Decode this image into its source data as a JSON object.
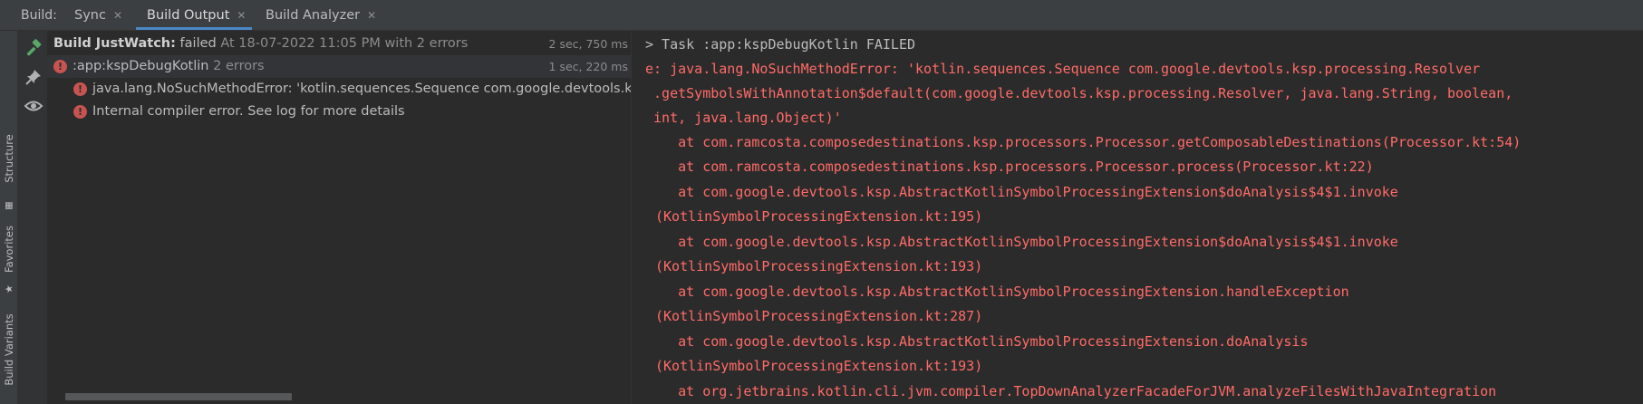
{
  "tabbar": {
    "build_label": "Build:",
    "tabs": [
      {
        "label": "Sync",
        "close": "✕"
      },
      {
        "label": "Build Output",
        "close": "✕"
      },
      {
        "label": "Build Analyzer",
        "close": "✕"
      }
    ]
  },
  "side_strip": {
    "structure_label": "Structure",
    "favorites_label": "Favorites",
    "build_variants_label": "Build Variants"
  },
  "tools": [
    "hammer-icon",
    "pin-icon",
    "eye-icon"
  ],
  "tree": {
    "root": {
      "title": "Build JustWatch:",
      "status": "failed",
      "detail": "At 18-07-2022 11:05 PM with 2 errors",
      "time": "2 sec, 750 ms"
    },
    "task": {
      "label": ":app:kspDebugKotlin",
      "count": "2 errors",
      "time": "1 sec, 220 ms"
    },
    "errors": [
      "java.lang.NoSuchMethodError: 'kotlin.sequences.Sequence com.google.devtools.ksp.processing.Resolver",
      "Internal compiler error. See log for more details"
    ]
  },
  "console": {
    "lines": [
      "> Task :app:kspDebugKotlin FAILED",
      "e: java.lang.NoSuchMethodError: 'kotlin.sequences.Sequence com.google.devtools.ksp.processing.Resolver",
      " .getSymbolsWithAnnotation$default(com.google.devtools.ksp.processing.Resolver, java.lang.String, boolean,",
      " int, java.lang.Object)'",
      "    at com.ramcosta.composedestinations.ksp.processors.Processor.getComposableDestinations(Processor.kt:54)",
      "    at com.ramcosta.composedestinations.ksp.processors.Processor.process(Processor.kt:22)",
      "    at com.google.devtools.ksp.AbstractKotlinSymbolProcessingExtension$doAnalysis$4$1.invoke",
      "(KotlinSymbolProcessingExtension.kt:195)",
      "    at com.google.devtools.ksp.AbstractKotlinSymbolProcessingExtension$doAnalysis$4$1.invoke",
      "(KotlinSymbolProcessingExtension.kt:193)",
      "    at com.google.devtools.ksp.AbstractKotlinSymbolProcessingExtension.handleException",
      "(KotlinSymbolProcessingExtension.kt:287)",
      "    at com.google.devtools.ksp.AbstractKotlinSymbolProcessingExtension.doAnalysis",
      "(KotlinSymbolProcessingExtension.kt:193)",
      "    at org.jetbrains.kotlin.cli.jvm.compiler.TopDownAnalyzerFacadeForJVM.analyzeFilesWithJavaIntegration"
    ]
  },
  "colors": {
    "error": "#ff6b68",
    "accent": "#4a88c7",
    "hammer": "#59a869"
  }
}
